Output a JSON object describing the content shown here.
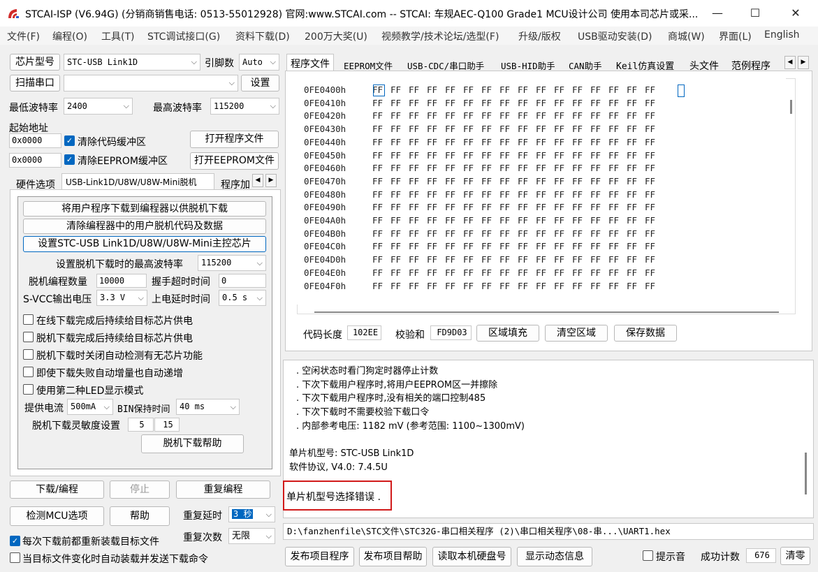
{
  "window": {
    "title": "STCAI-ISP (V6.94G) (分销商销售电话: 0513-55012928) 官网:www.STCAI.com  -- STCAI: 车规AEC-Q100 Grade1 MCU设计公司 使用本司芯片或采...",
    "minimize": "—",
    "maximize": "☐",
    "close": "✕"
  },
  "menu": [
    "文件(F)",
    "编程(O)",
    "工具(T)",
    "STC调试接口(G)",
    "资料下载(D)",
    "200万大奖(U)",
    "视频教学/技术论坛/选型(F)",
    "升级/版权",
    "USB驱动安装(D)",
    "商城(W)",
    "界面(L)",
    "English"
  ],
  "left": {
    "chip_type_btn": "芯片型号",
    "chip_type_value": "STC-USB Link1D",
    "pins_label": "引脚数",
    "pins_value": "Auto",
    "scan_port_btn": "扫描串口",
    "port_value": "",
    "settings_btn": "设置",
    "min_baud_label": "最低波特率",
    "min_baud_value": "2400",
    "max_baud_label": "最高波特率",
    "max_baud_value": "115200",
    "start_addr_label": "起始地址",
    "addr1": "0x0000",
    "clear_code_label": "清除代码缓冲区",
    "open_prog_btn": "打开程序文件",
    "addr2": "0x0000",
    "clear_eeprom_label": "清除EEPROM缓冲区",
    "open_eeprom_btn": "打开EEPROM文件",
    "tabs": [
      "硬件选项",
      "USB-Link1D/U8W/U8W-Mini脱机",
      "程序加"
    ],
    "panel": {
      "btn1": "将用户程序下载到编程器以供脱机下载",
      "btn2": "清除编程器中的用户脱机代码及数据",
      "btn3": "设置STC-USB Link1D/U8W/U8W-Mini主控芯片",
      "offline_baud_label": "设置脱机下载时的最高波特率",
      "offline_baud_value": "115200",
      "prog_count_label": "脱机编程数量",
      "prog_count_value": "10000",
      "handshake_label": "握手超时时间",
      "handshake_value": "0",
      "svcc_label": "S-VCC输出电压",
      "svcc_value": "3.3 V",
      "power_delay_label": "上电延时时间",
      "power_delay_value": "0.5 s",
      "checks": [
        "在线下载完成后持续给目标芯片供电",
        "脱机下载完成后持续给目标芯片供电",
        "脱机下载时关闭自动检测有无芯片功能",
        "即使下载失败自动增量也自动递增",
        "使用第二种LED显示模式"
      ],
      "current_label": "提供电流",
      "current_value": "500mA",
      "bin_label": "BIN保持时间",
      "bin_value": "40 ms",
      "sens_label": "脱机下载灵敏度设置",
      "sens_value1": "5",
      "sens_value2": "15",
      "help_btn": "脱机下载帮助"
    },
    "download_btn": "下载/编程",
    "stop_btn": "停止",
    "reprog_btn": "重复编程",
    "detect_btn": "检测MCU选项",
    "help_btn": "帮助",
    "repeat_delay_label": "重复延时",
    "repeat_delay_value": "3 秒",
    "repeat_count_label": "重复次数",
    "repeat_count_value": "无限",
    "reload_label": "每次下载前都重新装载目标文件",
    "autoload_label": "当目标文件变化时自动装载并发送下载命令"
  },
  "right": {
    "tabs": [
      "程序文件",
      "EEPROM文件",
      "USB-CDC/串口助手",
      "USB-HID助手",
      "CAN助手",
      "Keil仿真设置",
      "头文件",
      "范例程序"
    ],
    "hex_rows": [
      {
        "addr": "0FE0400h",
        "bytes": [
          "FF",
          "FF",
          "FF",
          "FF",
          "FF",
          "FF",
          "FF",
          "FF",
          "FF",
          "FF",
          "FF",
          "FF",
          "FF",
          "FF",
          "FF",
          "FF"
        ]
      },
      {
        "addr": "0FE0410h",
        "bytes": [
          "FF",
          "FF",
          "FF",
          "FF",
          "FF",
          "FF",
          "FF",
          "FF",
          "FF",
          "FF",
          "FF",
          "FF",
          "FF",
          "FF",
          "FF",
          "FF"
        ]
      },
      {
        "addr": "0FE0420h",
        "bytes": [
          "FF",
          "FF",
          "FF",
          "FF",
          "FF",
          "FF",
          "FF",
          "FF",
          "FF",
          "FF",
          "FF",
          "FF",
          "FF",
          "FF",
          "FF",
          "FF"
        ]
      },
      {
        "addr": "0FE0430h",
        "bytes": [
          "FF",
          "FF",
          "FF",
          "FF",
          "FF",
          "FF",
          "FF",
          "FF",
          "FF",
          "FF",
          "FF",
          "FF",
          "FF",
          "FF",
          "FF",
          "FF"
        ]
      },
      {
        "addr": "0FE0440h",
        "bytes": [
          "FF",
          "FF",
          "FF",
          "FF",
          "FF",
          "FF",
          "FF",
          "FF",
          "FF",
          "FF",
          "FF",
          "FF",
          "FF",
          "FF",
          "FF",
          "FF"
        ]
      },
      {
        "addr": "0FE0450h",
        "bytes": [
          "FF",
          "FF",
          "FF",
          "FF",
          "FF",
          "FF",
          "FF",
          "FF",
          "FF",
          "FF",
          "FF",
          "FF",
          "FF",
          "FF",
          "FF",
          "FF"
        ]
      },
      {
        "addr": "0FE0460h",
        "bytes": [
          "FF",
          "FF",
          "FF",
          "FF",
          "FF",
          "FF",
          "FF",
          "FF",
          "FF",
          "FF",
          "FF",
          "FF",
          "FF",
          "FF",
          "FF",
          "FF"
        ]
      },
      {
        "addr": "0FE0470h",
        "bytes": [
          "FF",
          "FF",
          "FF",
          "FF",
          "FF",
          "FF",
          "FF",
          "FF",
          "FF",
          "FF",
          "FF",
          "FF",
          "FF",
          "FF",
          "FF",
          "FF"
        ]
      },
      {
        "addr": "0FE0480h",
        "bytes": [
          "FF",
          "FF",
          "FF",
          "FF",
          "FF",
          "FF",
          "FF",
          "FF",
          "FF",
          "FF",
          "FF",
          "FF",
          "FF",
          "FF",
          "FF",
          "FF"
        ]
      },
      {
        "addr": "0FE0490h",
        "bytes": [
          "FF",
          "FF",
          "FF",
          "FF",
          "FF",
          "FF",
          "FF",
          "FF",
          "FF",
          "FF",
          "FF",
          "FF",
          "FF",
          "FF",
          "FF",
          "FF"
        ]
      },
      {
        "addr": "0FE04A0h",
        "bytes": [
          "FF",
          "FF",
          "FF",
          "FF",
          "FF",
          "FF",
          "FF",
          "FF",
          "FF",
          "FF",
          "FF",
          "FF",
          "FF",
          "FF",
          "FF",
          "FF"
        ]
      },
      {
        "addr": "0FE04B0h",
        "bytes": [
          "FF",
          "FF",
          "FF",
          "FF",
          "FF",
          "FF",
          "FF",
          "FF",
          "FF",
          "FF",
          "FF",
          "FF",
          "FF",
          "FF",
          "FF",
          "FF"
        ]
      },
      {
        "addr": "0FE04C0h",
        "bytes": [
          "FF",
          "FF",
          "FF",
          "FF",
          "FF",
          "FF",
          "FF",
          "FF",
          "FF",
          "FF",
          "FF",
          "FF",
          "FF",
          "FF",
          "FF",
          "FF"
        ]
      },
      {
        "addr": "0FE04D0h",
        "bytes": [
          "FF",
          "FF",
          "FF",
          "FF",
          "FF",
          "FF",
          "FF",
          "FF",
          "FF",
          "FF",
          "FF",
          "FF",
          "FF",
          "FF",
          "FF",
          "FF"
        ]
      },
      {
        "addr": "0FE04E0h",
        "bytes": [
          "FF",
          "FF",
          "FF",
          "FF",
          "FF",
          "FF",
          "FF",
          "FF",
          "FF",
          "FF",
          "FF",
          "FF",
          "FF",
          "FF",
          "FF",
          "FF"
        ]
      },
      {
        "addr": "0FE04F0h",
        "bytes": [
          "FF",
          "FF",
          "FF",
          "FF",
          "FF",
          "FF",
          "FF",
          "FF",
          "FF",
          "FF",
          "FF",
          "FF",
          "FF",
          "FF",
          "FF",
          "FF"
        ]
      }
    ],
    "code_len_label": "代码长度",
    "code_len_value": "102EE",
    "checksum_label": "校验和",
    "checksum_value": "FD9D03",
    "fill_btn": "区域填充",
    "clear_btn": "清空区域",
    "save_btn": "保存数据",
    "log_lines": [
      ". 空闲状态时看门狗定时器停止计数",
      ". 下次下载用户程序时,将用户EEPROM区一并擦除",
      ". 下次下载用户程序时,没有相关的端口控制485",
      ". 下次下载时不需要校验下载口令",
      ". 内部参考电压: 1182 mV (参考范围: 1100~1300mV)",
      "",
      "单片机型号: STC-USB Link1D",
      "软件协议, V4.0: 7.4.5U"
    ],
    "error_msg": "单片机型号选择错误 .",
    "file_path": "D:\\fanzhenfile\\STC文件\\STC32G-串口相关程序 (2)\\串口相关程序\\08-串...\\UART1.hex",
    "publish_btn": "发布项目程序",
    "publish_help_btn": "发布项目帮助",
    "read_disk_btn": "读取本机硬盘号",
    "show_dynamic_btn": "显示动态信息",
    "beep_label": "提示音",
    "success_label": "成功计数",
    "success_value": "676",
    "clear_count_btn": "清零"
  },
  "colors": {
    "accent": "#0067c0",
    "error_border": "#d11a1a",
    "selection": "#0067c0"
  }
}
